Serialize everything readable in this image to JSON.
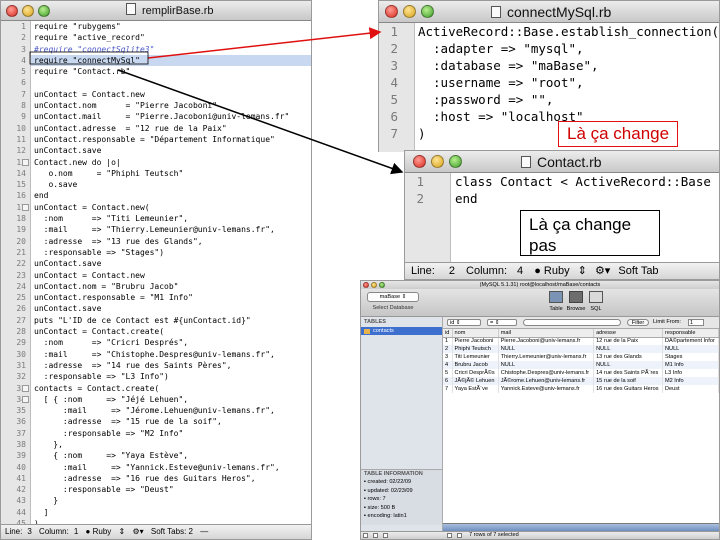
{
  "main_window": {
    "title": "remplirBase.rb",
    "line_numbers": [
      "1",
      "2",
      "3",
      "4",
      "5",
      "6",
      "7",
      "8",
      "9",
      "10",
      "11",
      "12",
      "13",
      "14",
      "15",
      "16",
      "17",
      "18",
      "19",
      "20",
      "21",
      "22",
      "23",
      "24",
      "25",
      "26",
      "27",
      "28",
      "29",
      "30",
      "31",
      "32",
      "33",
      "34",
      "35",
      "36",
      "37",
      "38",
      "39",
      "40",
      "41",
      "42",
      "43",
      "44",
      "45"
    ],
    "code_lines": [
      {
        "t": "require \"rubygems\"",
        "c": "ok"
      },
      {
        "t": "require \"active_record\"",
        "c": "ok"
      },
      {
        "t": "#require \"connectSqlite3\"",
        "c": "cm"
      },
      {
        "t": "require \"connectMySql\"",
        "c": "ok",
        "hl": true
      },
      {
        "t": "require \"Contact.rb\"",
        "c": "ok"
      },
      {
        "t": "",
        "c": "ok"
      },
      {
        "t": "unContact = Contact.new",
        "c": "ok"
      },
      {
        "t": "unContact.nom      = \"Pierre Jacoboni\"",
        "c": "ok"
      },
      {
        "t": "unContact.mail     = \"Pierre.Jacoboni@univ-lemans.fr\"",
        "c": "ok"
      },
      {
        "t": "unContact.adresse  = \"12 rue de la Paix\"",
        "c": "ok"
      },
      {
        "t": "unContact.responsable = \"Département Informatique\"",
        "c": "ok"
      },
      {
        "t": "unContact.save",
        "c": "ok"
      },
      {
        "t": "Contact.new do |o|",
        "c": "ok"
      },
      {
        "t": "   o.nom     = \"Phiphi Teutsch\"",
        "c": "ok"
      },
      {
        "t": "   o.save",
        "c": "ok"
      },
      {
        "t": "end",
        "c": "ok"
      },
      {
        "t": "unContact = Contact.new(",
        "c": "ok"
      },
      {
        "t": "  :nom      => \"Titi Lemeunier\",",
        "c": "ok"
      },
      {
        "t": "  :mail     => \"Thierry.Lemeunier@univ-lemans.fr\",",
        "c": "ok"
      },
      {
        "t": "  :adresse  => \"13 rue des Glands\",",
        "c": "ok"
      },
      {
        "t": "  :responsable => \"Stages\")",
        "c": "ok"
      },
      {
        "t": "unContact.save",
        "c": "ok"
      },
      {
        "t": "unContact = Contact.new",
        "c": "ok"
      },
      {
        "t": "unContact.nom = \"Brubru Jacob\"",
        "c": "ok"
      },
      {
        "t": "unContact.responsable = \"M1 Info\"",
        "c": "ok"
      },
      {
        "t": "unContact.save",
        "c": "ok"
      },
      {
        "t": "puts \"L'ID de ce Contact est #{unContact.id}\"",
        "c": "ok"
      },
      {
        "t": "unContact = Contact.create(",
        "c": "ok"
      },
      {
        "t": "  :nom      => \"Cricri Després\",",
        "c": "ok"
      },
      {
        "t": "  :mail     => \"Chistophe.Despres@univ-lemans.fr\",",
        "c": "ok"
      },
      {
        "t": "  :adresse  => \"14 rue des Saints Pères\",",
        "c": "ok"
      },
      {
        "t": "  :responsable => \"L3 Info\")",
        "c": "ok"
      },
      {
        "t": "contacts = Contact.create(",
        "c": "ok"
      },
      {
        "t": "  [ { :nom     => \"Jéjé Lehuen\",",
        "c": "ok"
      },
      {
        "t": "      :mail     => \"Jérome.Lehuen@univ-lemans.fr\",",
        "c": "ok"
      },
      {
        "t": "      :adresse  => \"15 rue de la soif\",",
        "c": "ok"
      },
      {
        "t": "      :responsable => \"M2 Info\"",
        "c": "ok"
      },
      {
        "t": "    },",
        "c": "ok"
      },
      {
        "t": "    { :nom     => \"Yaya Estève\",",
        "c": "ok"
      },
      {
        "t": "      :mail     => \"Yannick.Esteve@univ-lemans.fr\",",
        "c": "ok"
      },
      {
        "t": "      :adresse  => \"16 rue des Guitars Heros\",",
        "c": "ok"
      },
      {
        "t": "      :responsable => \"Deust\"",
        "c": "ok"
      },
      {
        "t": "    }",
        "c": "ok"
      },
      {
        "t": "  ]",
        "c": "ok"
      },
      {
        "t": ")",
        "c": "ok"
      }
    ],
    "status": {
      "line_label": "Line:",
      "line": "3",
      "column_label": "Column:",
      "column": "1",
      "language": "Ruby",
      "soft_tabs": "Soft Tabs: 2",
      "dash": "—"
    }
  },
  "connect_window": {
    "title": "connectMySql.rb",
    "line_numbers": [
      "1",
      "2",
      "3",
      "4",
      "5",
      "6",
      "7"
    ],
    "code_lines": [
      "ActiveRecord::Base.establish_connection(",
      "  :adapter => \"mysql\",",
      "  :database => \"maBase\",",
      "  :username => \"root\",",
      "  :password => \"\",",
      "  :host => \"localhost\"",
      ")"
    ],
    "note": "Là ça change"
  },
  "contact_window": {
    "title": "Contact.rb",
    "line_numbers": [
      "1",
      "2"
    ],
    "code_lines": [
      "class Contact < ActiveRecord::Base",
      "end"
    ],
    "note": "Là ça change pas",
    "status": {
      "line_label": "Line:",
      "line": "2",
      "column_label": "Column:",
      "column": "4",
      "language": "Ruby",
      "soft_tabs": "Soft Tab"
    }
  },
  "mysql_window": {
    "title": "(MySQL 5.1.31) root@localhost/maBase/contacts",
    "database": "maBase",
    "select_database_label": "Select Database",
    "toolbar": [
      "Table",
      "Browse",
      "SQL"
    ],
    "tables_header": "TABLES",
    "tables": [
      "contacts"
    ],
    "filter": {
      "field": "id",
      "operator": "=",
      "button": "Filter",
      "limit_label": "Limit From:",
      "limit_value": "1"
    },
    "columns": [
      "id",
      "nom",
      "mail",
      "adresse",
      "responsable"
    ],
    "rows": [
      [
        "1",
        "Pierre Jacoboni",
        "Pierre.Jacoboni@univ-lemans.fr",
        "12 rue de la Paix",
        "DÃ©partement Infor"
      ],
      [
        "2",
        "Phiphi Teutsch",
        "NULL",
        "NULL",
        "NULL"
      ],
      [
        "3",
        "Titi Lemeunier",
        "Thierry.Lemeunier@univ-lemans.fr",
        "13 rue des Glands",
        "Stages"
      ],
      [
        "4",
        "Brubru Jacob",
        "NULL",
        "NULL",
        "M1 Info"
      ],
      [
        "5",
        "Cricri DesprÃ©s",
        "Chistophe.Despres@univ-lemans.fr",
        "14 rue des Saints PÃ¨res",
        "L3 Info"
      ],
      [
        "6",
        "JÃ©jÃ© Lehuen",
        "JÃ©rome.Lehuen@univ-lemans.fr",
        "15 rue de la soif",
        "M2 Info"
      ],
      [
        "7",
        "Yaya EstÃ¨ve",
        "Yannick.Esteve@univ-lemans.fr",
        "16 rue des Guitars Heros",
        "Deust"
      ]
    ],
    "info_header": "TABLE INFORMATION",
    "info": [
      "created: 02/22/09",
      "updated: 02/23/09",
      "rows: 7",
      "size: 500 B",
      "encoding: latin1"
    ],
    "status": "7 rows of 7 selected"
  }
}
